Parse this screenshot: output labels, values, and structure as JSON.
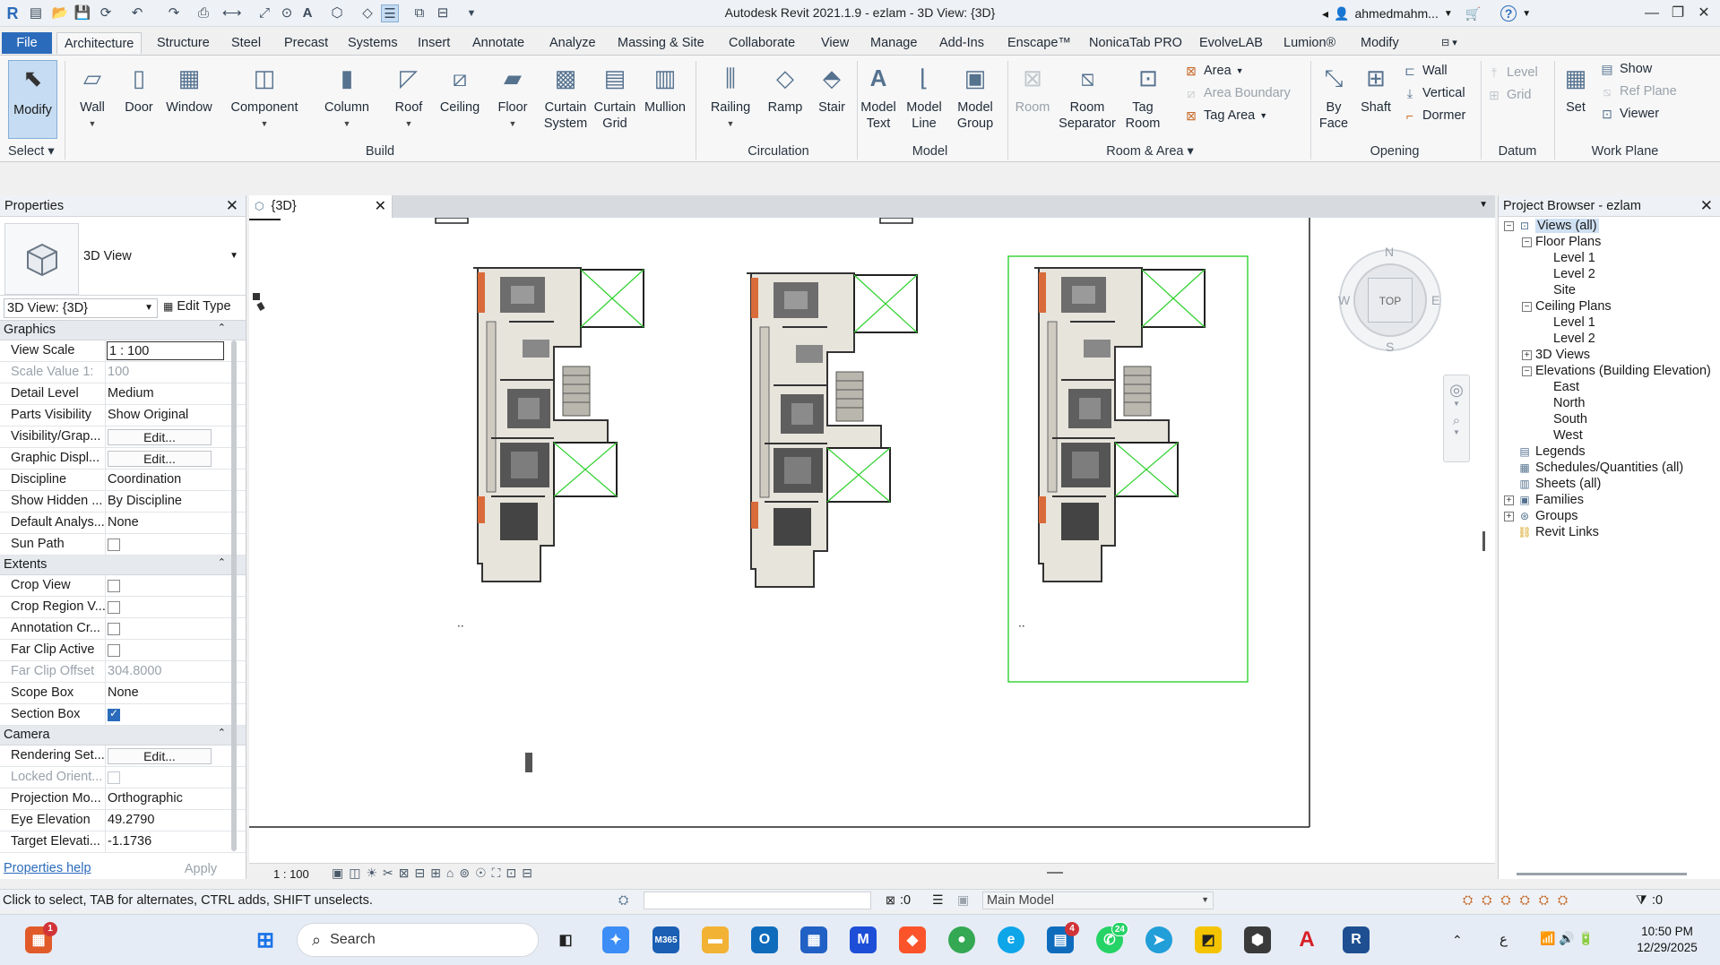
{
  "app": {
    "title": "Autodesk Revit 2021.1.9 - ezlam - 3D View: {3D}",
    "user": "ahmedmahm...",
    "window_buttons": [
      "—",
      "❐",
      "✕"
    ]
  },
  "ribbon_tabs": [
    "File",
    "Architecture",
    "Structure",
    "Steel",
    "Precast",
    "Systems",
    "Insert",
    "Annotate",
    "Analyze",
    "Massing & Site",
    "Collaborate",
    "View",
    "Manage",
    "Add-Ins",
    "Enscape™",
    "NonicaTab PRO",
    "EvolveLAB",
    "Lumion®",
    "Modify"
  ],
  "ribbon": {
    "modify": "Modify",
    "select": "Select",
    "build": {
      "label": "Build",
      "items": [
        "Wall",
        "Door",
        "Window",
        "Component",
        "Column",
        "Roof",
        "Ceiling",
        "Floor",
        "Curtain System",
        "Curtain Grid",
        "Mullion"
      ]
    },
    "circulation": {
      "label": "Circulation",
      "items": [
        "Railing",
        "Ramp",
        "Stair"
      ]
    },
    "model": {
      "label": "Model",
      "items": [
        "Model Text",
        "Model Line",
        "Model Group"
      ]
    },
    "room_area": {
      "label": "Room & Area",
      "items": [
        "Room",
        "Room Separator",
        "Tag Room"
      ],
      "small": [
        "Area",
        "Area  Boundary",
        "Tag  Area"
      ]
    },
    "opening": {
      "label": "Opening",
      "items": [
        "By Face",
        "Shaft"
      ],
      "small": [
        "Wall",
        "Vertical",
        "Dormer"
      ]
    },
    "datum": {
      "label": "Datum",
      "small": [
        "Level",
        "Grid"
      ]
    },
    "work_plane": {
      "label": "Work Plane",
      "set": "Set",
      "small": [
        "Show",
        "Ref  Plane",
        "Viewer"
      ]
    }
  },
  "properties": {
    "title": "Properties",
    "type_name": "3D View",
    "view_selector": "3D View: {3D}",
    "edit_type": "Edit Type",
    "groups": [
      {
        "name": "Graphics",
        "rows": [
          {
            "name": "View Scale",
            "value": "1 : 100",
            "kind": "input"
          },
          {
            "name": "Scale Value    1:",
            "value": "100",
            "kind": "dim"
          },
          {
            "name": "Detail Level",
            "value": "Medium",
            "kind": "text"
          },
          {
            "name": "Parts Visibility",
            "value": "Show Original",
            "kind": "text"
          },
          {
            "name": "Visibility/Grap...",
            "value": "Edit...",
            "kind": "button"
          },
          {
            "name": "Graphic Displ...",
            "value": "Edit...",
            "kind": "button"
          },
          {
            "name": "Discipline",
            "value": "Coordination",
            "kind": "text"
          },
          {
            "name": "Show Hidden ...",
            "value": "By Discipline",
            "kind": "text"
          },
          {
            "name": "Default Analys...",
            "value": "None",
            "kind": "text"
          },
          {
            "name": "Sun Path",
            "value": "",
            "kind": "check"
          }
        ]
      },
      {
        "name": "Extents",
        "rows": [
          {
            "name": "Crop View",
            "value": "",
            "kind": "check"
          },
          {
            "name": "Crop Region V...",
            "value": "",
            "kind": "check"
          },
          {
            "name": "Annotation Cr...",
            "value": "",
            "kind": "check"
          },
          {
            "name": "Far Clip Active",
            "value": "",
            "kind": "check"
          },
          {
            "name": "Far Clip Offset",
            "value": "304.8000",
            "kind": "dim"
          },
          {
            "name": "Scope Box",
            "value": "None",
            "kind": "text"
          },
          {
            "name": "Section Box",
            "value": "",
            "kind": "check-on"
          }
        ]
      },
      {
        "name": "Camera",
        "rows": [
          {
            "name": "Rendering Set...",
            "value": "Edit...",
            "kind": "button"
          },
          {
            "name": "Locked Orient...",
            "value": "",
            "kind": "check-dim"
          },
          {
            "name": "Projection Mo...",
            "value": "Orthographic",
            "kind": "text"
          },
          {
            "name": "Eye Elevation",
            "value": "49.2790",
            "kind": "text"
          },
          {
            "name": "Target Elevati...",
            "value": "-1.1736",
            "kind": "text"
          }
        ]
      }
    ],
    "help_link": "Properties help",
    "apply": "Apply"
  },
  "view": {
    "tab_label": "{3D}",
    "scale": "1 : 100",
    "viewcube": {
      "face": "TOP",
      "n": "N",
      "s": "S",
      "e": "E",
      "w": "W"
    }
  },
  "browser": {
    "title": "Project Browser - ezlam",
    "nodes": [
      {
        "label": "Views (all)",
        "level": 0,
        "toggle": "−",
        "icon": "views-icon"
      },
      {
        "label": "Floor Plans",
        "level": 1,
        "toggle": "−"
      },
      {
        "label": "Level 1",
        "level": 2
      },
      {
        "label": "Level 2",
        "level": 2
      },
      {
        "label": "Site",
        "level": 2
      },
      {
        "label": "Ceiling Plans",
        "level": 1,
        "toggle": "−"
      },
      {
        "label": "Level 1",
        "level": 2
      },
      {
        "label": "Level 2",
        "level": 2
      },
      {
        "label": "3D Views",
        "level": 1,
        "toggle": "+"
      },
      {
        "label": "Elevations (Building Elevation)",
        "level": 1,
        "toggle": "−"
      },
      {
        "label": "East",
        "level": 2
      },
      {
        "label": "North",
        "level": 2
      },
      {
        "label": "South",
        "level": 2
      },
      {
        "label": "West",
        "level": 2
      },
      {
        "label": "Legends",
        "level": 0,
        "icon": "legends-icon"
      },
      {
        "label": "Schedules/Quantities (all)",
        "level": 0,
        "icon": "schedules-icon"
      },
      {
        "label": "Sheets (all)",
        "level": 0,
        "icon": "sheets-icon"
      },
      {
        "label": "Families",
        "level": 0,
        "toggle": "+",
        "icon": "families-icon"
      },
      {
        "label": "Groups",
        "level": 0,
        "toggle": "+",
        "icon": "groups-icon"
      },
      {
        "label": "Revit Links",
        "level": 0,
        "icon": "links-icon"
      }
    ]
  },
  "statusbar": {
    "message": "Click to select, TAB for alternates, CTRL adds, SHIFT unselects.",
    "zero": ":0",
    "workset": "Main Model",
    "filter_count": ":0"
  },
  "taskbar": {
    "search": "Search",
    "time": "10:50 PM",
    "date": "12/29/2025",
    "badges": {
      "store": "1",
      "outlook": "4",
      "whatsapp": "24"
    },
    "lang": "ع"
  },
  "colors": {
    "accent": "#2b6bbb",
    "section_box": "#2fd12f",
    "plan_floor": "#e7e4dc",
    "orange": "#d96b3a"
  }
}
